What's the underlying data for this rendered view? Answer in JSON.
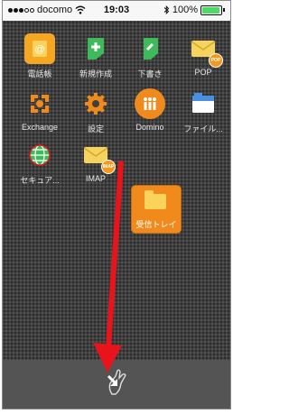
{
  "status_bar": {
    "carrier": "docomo",
    "time": "19:03",
    "battery": "100%",
    "battery_level": 1.0,
    "wifi_icon": "wifi-icon",
    "bluetooth_icon": "bluetooth-icon"
  },
  "apps": [
    {
      "label": "電話帳",
      "icon": "contacts-icon",
      "color": "#f5a623"
    },
    {
      "label": "新規作成",
      "icon": "compose-icon",
      "color": "#3dbb5b"
    },
    {
      "label": "下書き",
      "icon": "draft-icon",
      "color": "#3dbb5b"
    },
    {
      "label": "POP",
      "icon": "mail-pop-icon",
      "color": "#f6d35c"
    },
    {
      "label": "Exchange",
      "icon": "exchange-icon",
      "color": "#f08a1c"
    },
    {
      "label": "設定",
      "icon": "gear-icon",
      "color": "#f08a1c"
    },
    {
      "label": "Domino",
      "icon": "domino-icon",
      "color": "#f08a1c"
    },
    {
      "label": "ファイル...",
      "icon": "file-icon",
      "color": "#4a90e2"
    },
    {
      "label": "セキュア...",
      "icon": "globe-icon",
      "color": "#3dbb5b"
    },
    {
      "label": "IMAP",
      "icon": "mail-imap-icon",
      "color": "#f6d35c"
    }
  ],
  "drop_target": {
    "label": "受信トレイ",
    "icon": "inbox-folder-icon"
  },
  "gesture": {
    "arrow": "drag-arrow",
    "hand": "drag-hand-icon",
    "arrow_color": "#e8131b"
  }
}
